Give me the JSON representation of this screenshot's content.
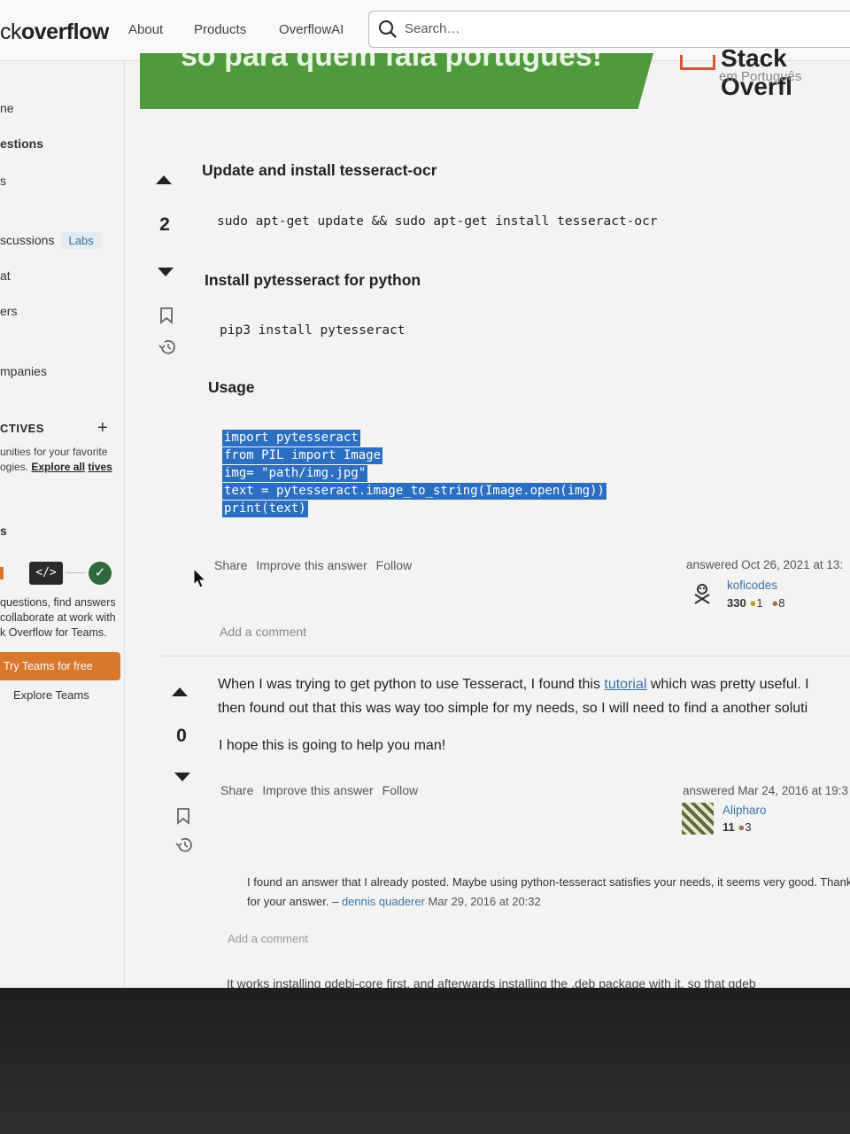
{
  "topbar": {
    "logo_prefix": "ck",
    "logo_bold": "overflow",
    "nav": [
      "About",
      "Products",
      "OverflowAI"
    ],
    "search_placeholder": "Search…"
  },
  "sidebar": {
    "items": [
      "ne",
      "estions",
      "s",
      "scussions",
      "at",
      "ers",
      "mpanies"
    ],
    "labs_badge": "Labs",
    "collectives_title": "CTIVES",
    "collectives_text": "unities for your favorite ogies.",
    "explore_all": "Explore all",
    "collectives_link2": "tives",
    "teams_heading": "s",
    "teams_text": "questions, find answers collaborate at work with k Overflow for Teams.",
    "try_teams": "Try Teams for free",
    "explore_teams": "Explore Teams"
  },
  "banner": {
    "text": "só para quem fala português!",
    "brand_name": "Stack Overfl",
    "brand_sub": "em Português"
  },
  "answer1": {
    "score": "2",
    "heading1": "Update and install tesseract-ocr",
    "code1": "sudo apt-get update && sudo apt-get install tesseract-ocr",
    "heading2": "Install pytesseract for python",
    "code2": "pip3 install pytesseract",
    "heading3": "Usage",
    "code3": [
      "import pytesseract",
      "from PIL import Image",
      "img= \"path/img.jpg\"",
      "text = pytesseract.image_to_string(Image.open(img))",
      "print(text)"
    ],
    "menu": [
      "Share",
      "Improve this answer",
      "Follow"
    ],
    "answered": "answered Oct 26, 2021 at 13:",
    "user": "koficodes",
    "rep": "330",
    "gold": "1",
    "bronze": "8",
    "add_comment": "Add a comment"
  },
  "answer2": {
    "score": "0",
    "para1_before": "When I was trying to get python to use Tesseract, I found this ",
    "para1_link": "tutorial",
    "para1_after": " which was pretty useful. I",
    "para1_line2": "then found out that this was way too simple for my needs, so I will need to find a another soluti",
    "para2": "I hope this is going to help you man!",
    "menu": [
      "Share",
      "Improve this answer",
      "Follow"
    ],
    "answered": "answered Mar 24, 2016 at 19:3",
    "user": "Alipharo",
    "rep": "11",
    "bronze": "3",
    "comment_text": "I found an answer that I already posted. Maybe using python-tesseract satisfies your needs, it seems very good. Thanks for your answer. –",
    "comment_user": "dennis quaderer",
    "comment_date": "Mar 29, 2016 at 20:32",
    "add_comment": "Add a comment"
  },
  "answer3_cut": "It works installing gdebi-core first, and afterwards installing the .deb package with it, so that gdeb"
}
